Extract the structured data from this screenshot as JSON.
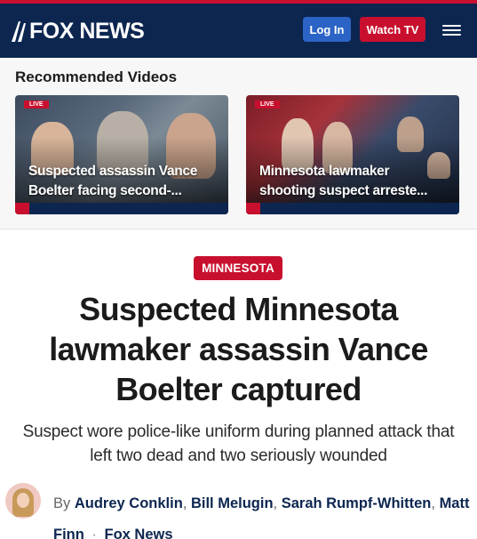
{
  "header": {
    "logo_text": "FOX NEWS",
    "login_label": "Log In",
    "watch_label": "Watch TV",
    "brand_color": "#0c2650",
    "accent_color": "#c8102e",
    "menu_icon": "hamburger-menu-icon"
  },
  "recommended": {
    "title": "Recommended Videos",
    "cards": [
      {
        "caption_line1": "Suspected assassin Vance",
        "caption_line2": "Boelter facing second-..."
      },
      {
        "caption_line1": "Minnesota lawmaker",
        "caption_line2": "shooting suspect arreste..."
      }
    ]
  },
  "article": {
    "kicker": "MINNESOTA",
    "headline": "Suspected Minnesota lawmaker assassin Vance Boelter captured",
    "dek": "Suspect wore police-like uniform during planned attack that left two dead and two seriously wounded",
    "by_label": "By",
    "authors": [
      "Audrey Conklin",
      "Bill Melugin",
      "Sarah Rumpf-Whitten",
      "Matt Finn"
    ],
    "source": "Fox News"
  }
}
